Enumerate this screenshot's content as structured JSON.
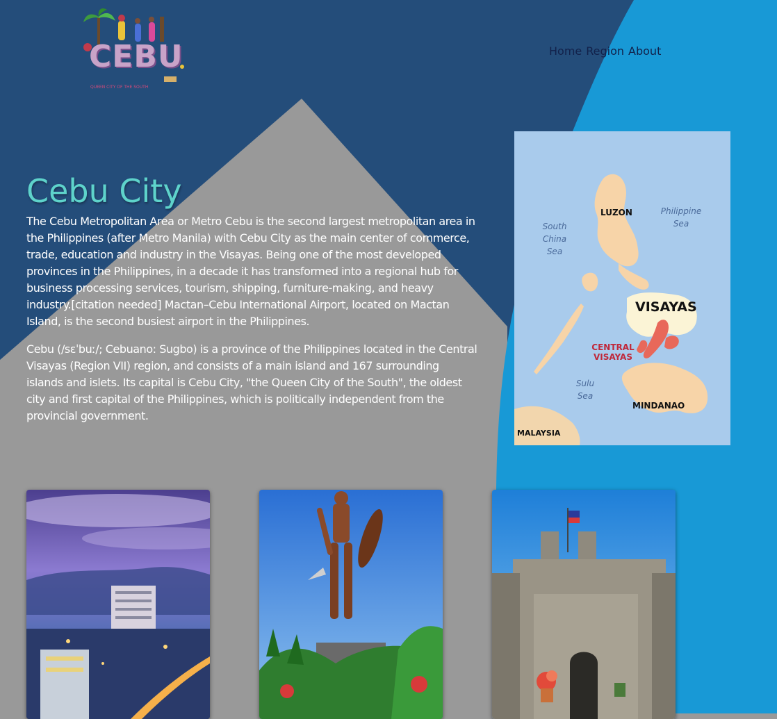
{
  "logo": {
    "title": "CEBU",
    "tagline": "QUEEN CITY OF THE SOUTH"
  },
  "nav": {
    "items": [
      "Home",
      "Region",
      "About"
    ]
  },
  "hero": {
    "title": "Cebu City",
    "paragraphs": [
      "The Cebu Metropolitan Area or Metro Cebu is the second largest metropolitan area in the Philippines (after Metro Manila) with Cebu City as the main center of commerce, trade, education and industry in the Visayas. Being one of the most developed provinces in the Philippines, in a decade it has transformed into a regional hub for business processing services, tourism, shipping, furniture-making, and heavy industry.[citation needed] Mactan–Cebu International Airport, located on Mactan Island, is the second busiest airport in the Philippines.",
      "Cebu (/sɛˈbuː/; Cebuano: Sugbo) is a province of the Philippines located in the Central Visayas (Region VII) region, and consists of a main island and 167 surrounding islands and islets. Its capital is Cebu City, \"the Queen City of the South\", the oldest city and first capital of the Philippines, which is politically independent from the provincial government."
    ]
  },
  "map": {
    "labels": {
      "luzon": "LUZON",
      "philippine_sea": "Philippine Sea",
      "south_china_sea": "South China Sea",
      "visayas": "VISAYAS",
      "central_visayas": "CENTRAL VISAYAS",
      "sulu_sea": "Sulu Sea",
      "mindanao": "MINDANAO",
      "malaysia": "MALAYSIA"
    }
  },
  "colors": {
    "dark_navy": "#244d7a",
    "bright_blue": "#1899d6",
    "gray_panel": "#999999",
    "title_teal": "#5ed3cb",
    "nav_text": "#12214a"
  }
}
